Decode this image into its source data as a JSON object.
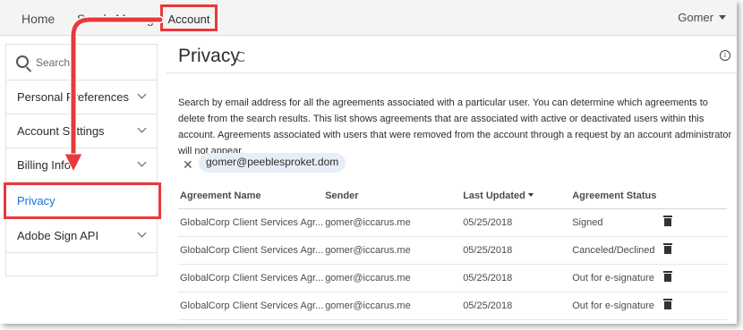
{
  "nav": {
    "home": "Home",
    "send": "Send",
    "manage": "Manage",
    "account": "Account",
    "user": "Gomer"
  },
  "sidebar": {
    "search": "Search",
    "items": [
      {
        "label": "Personal Preferences"
      },
      {
        "label": "Account Settings"
      },
      {
        "label": "Billing Info"
      },
      {
        "label": "Privacy"
      },
      {
        "label": "Adobe Sign API"
      }
    ]
  },
  "main": {
    "title": "Privacy",
    "description": "Search by email address for all the agreements associated with a particular user. You can determine which agreements to delete from the search results. This list shows agreements that are associated with active or deactivated users within this account. Agreements associated with users that were removed from the account through a request by an account administrator will not appear.",
    "chip": "gomer@peeblesproket.dom",
    "columns": [
      "Agreement Name",
      "Sender",
      "Last Updated",
      "Agreement Status"
    ],
    "rows": [
      {
        "name": "GlobalCorp Client Services Agr...",
        "sender": "gomer@iccarus.me",
        "updated": "05/25/2018",
        "status": "Signed"
      },
      {
        "name": "GlobalCorp Client Services Agr...",
        "sender": "gomer@iccarus.me",
        "updated": "05/25/2018",
        "status": "Canceled/Declined"
      },
      {
        "name": "GlobalCorp Client Services Agr...",
        "sender": "gomer@iccarus.me",
        "updated": "05/25/2018",
        "status": "Out for e-signature"
      },
      {
        "name": "GlobalCorp Client Services Agr...",
        "sender": "gomer@iccarus.me",
        "updated": "05/25/2018",
        "status": "Out for e-signature"
      }
    ]
  },
  "colors": {
    "accent": "#1473e6",
    "callout": "#e8393c"
  },
  "icons": [
    "search-icon",
    "refresh-icon",
    "info-icon",
    "close-icon",
    "sort-desc-icon",
    "trash-icon",
    "chevron-down-icon"
  ]
}
